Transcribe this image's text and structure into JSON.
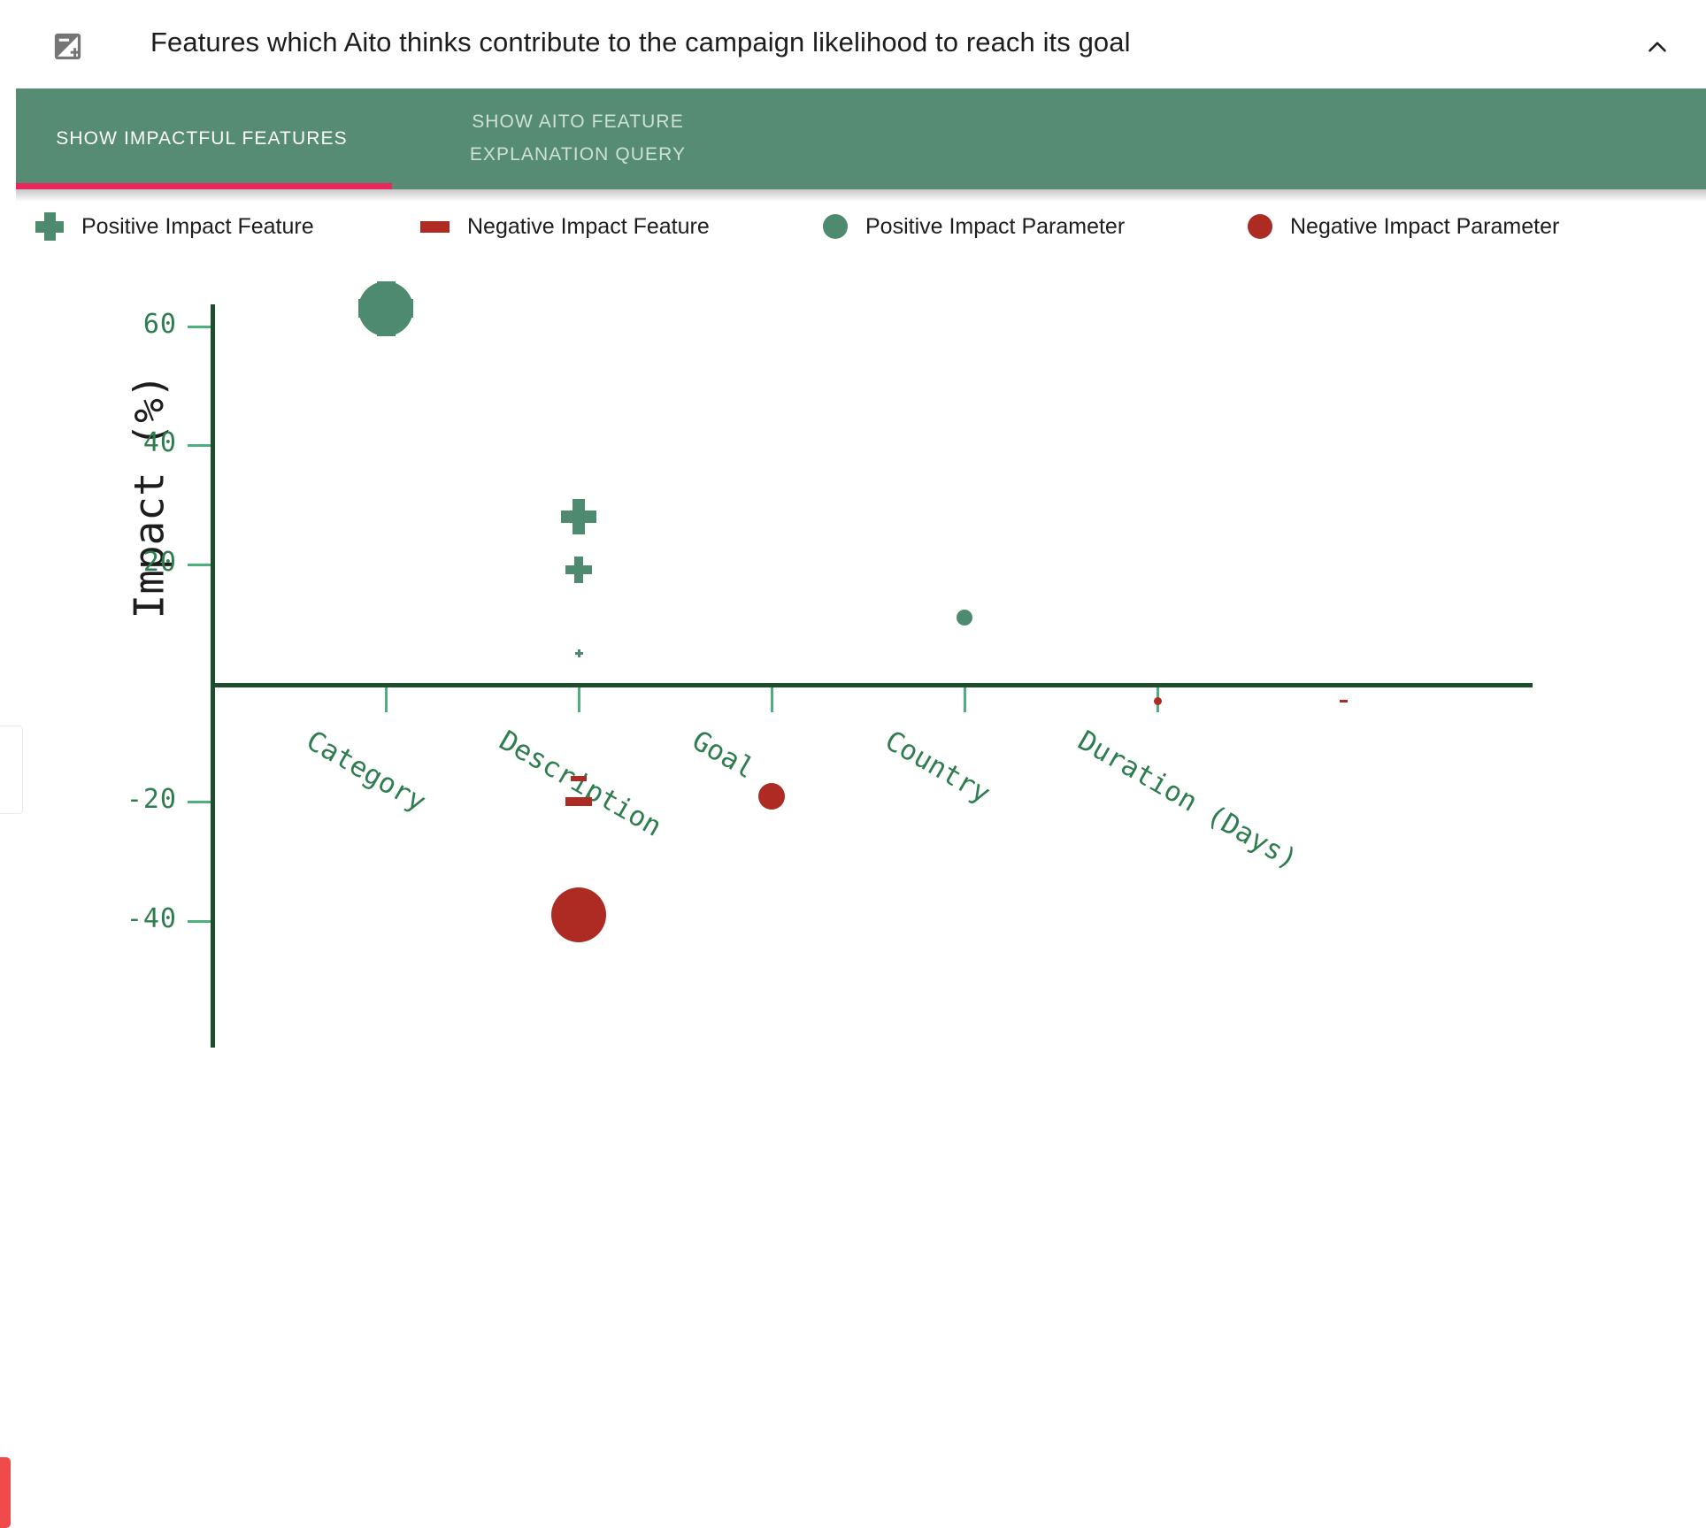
{
  "header": {
    "title": "Features which Aito thinks contribute to the campaign likelihood to reach its goal",
    "icon": "exposure-icon",
    "collapse_icon": "chevron-up-icon"
  },
  "tabs": [
    {
      "id": "show-impactful-features",
      "label": "SHOW IMPACTFUL FEATURES",
      "active": true
    },
    {
      "id": "show-aito-feature-explanation-query",
      "label": "SHOW AITO FEATURE EXPLANATION QUERY",
      "active": false
    }
  ],
  "legend": [
    {
      "id": "positive-impact-feature",
      "label": "Positive Impact Feature",
      "marker": "plus",
      "color": "#4e8a6f"
    },
    {
      "id": "negative-impact-feature",
      "label": "Negative Impact Feature",
      "marker": "minus",
      "color": "#ad2b23"
    },
    {
      "id": "positive-impact-parameter",
      "label": "Positive Impact Parameter",
      "marker": "circle",
      "color": "#4e8a6f"
    },
    {
      "id": "negative-impact-parameter",
      "label": "Negative Impact Parameter",
      "marker": "circle",
      "color": "#ad2b23"
    }
  ],
  "colors": {
    "accent_green": "#558c73",
    "underline_pink": "#e8275a",
    "axis_green": "#1d4d2e",
    "tick_green": "#4caf7d",
    "positive": "#4e8a6f",
    "negative": "#ad2b23",
    "label_green": "#2e7d4f"
  },
  "chart_data": {
    "type": "scatter",
    "title": "Features which Aito thinks contribute to the campaign likelihood to reach its goal",
    "xlabel": "",
    "ylabel": "Impact (%)",
    "categories": [
      "Category",
      "Description",
      "Goal",
      "Country",
      "Duration (Days)"
    ],
    "ytick_labels": [
      "60",
      "40",
      "20",
      "-20",
      "-40"
    ],
    "ytick_values": [
      60,
      40,
      20,
      -20,
      -40
    ],
    "ylim": [
      -45,
      68
    ],
    "grid": false,
    "legend_position": "top",
    "zero_line": 0,
    "points": [
      {
        "category": "Category",
        "impact": 63,
        "marker": "parameter",
        "sign": "positive",
        "size": "xlarge"
      },
      {
        "category": "Category",
        "impact": 63,
        "marker": "feature",
        "sign": "positive",
        "size": "xlarge"
      },
      {
        "category": "Description",
        "impact": 28,
        "marker": "feature",
        "sign": "positive",
        "size": "large"
      },
      {
        "category": "Description",
        "impact": 19,
        "marker": "feature",
        "sign": "positive",
        "size": "medium"
      },
      {
        "category": "Description",
        "impact": 5,
        "marker": "feature",
        "sign": "positive",
        "size": "tiny"
      },
      {
        "category": "Description",
        "impact": -16,
        "marker": "feature",
        "sign": "negative",
        "size": "small"
      },
      {
        "category": "Description",
        "impact": -20,
        "marker": "feature",
        "sign": "negative",
        "size": "medium"
      },
      {
        "category": "Description",
        "impact": -39,
        "marker": "parameter",
        "sign": "negative",
        "size": "xlarge"
      },
      {
        "category": "Description",
        "impact": -39,
        "marker": "feature",
        "sign": "negative",
        "size": "large"
      },
      {
        "category": "Goal",
        "impact": -19,
        "marker": "parameter",
        "sign": "negative",
        "size": "medium"
      },
      {
        "category": "Country",
        "impact": 11,
        "marker": "parameter",
        "sign": "positive",
        "size": "small"
      },
      {
        "category": "Duration (Days)",
        "impact": -3,
        "marker": "parameter",
        "sign": "negative",
        "size": "tiny"
      },
      {
        "category": "",
        "impact": -3,
        "marker": "feature",
        "sign": "negative",
        "size": "tiny"
      }
    ]
  }
}
